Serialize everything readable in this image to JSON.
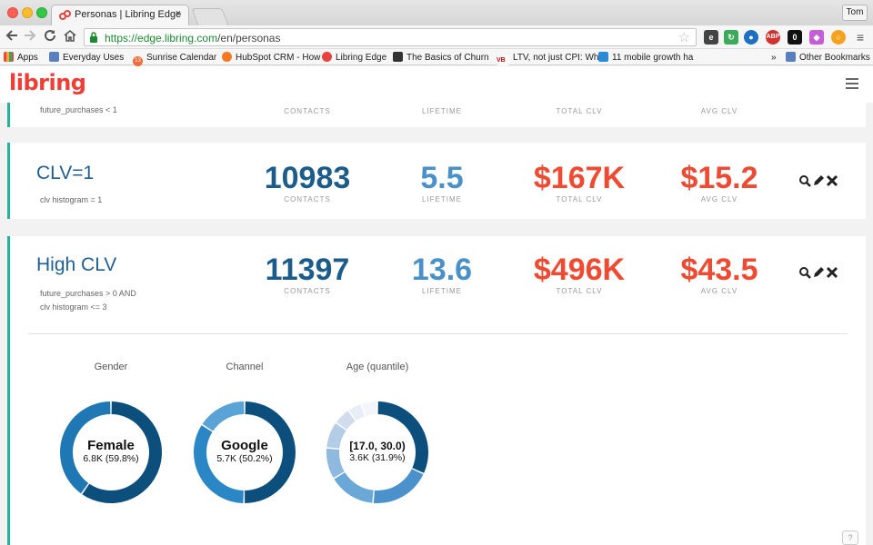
{
  "browser": {
    "tab_title": "Personas | Libring Edge",
    "tab_close": "×",
    "user_label": "Tom",
    "url_secure": "https://edge.libring.com",
    "url_path": "/en/personas",
    "bookmarks": [
      {
        "label": "Apps"
      },
      {
        "label": "Everyday Uses"
      },
      {
        "label": "Sunrise Calendar"
      },
      {
        "label": "HubSpot CRM - How"
      },
      {
        "label": "Libring Edge"
      },
      {
        "label": "The Basics of Churn"
      },
      {
        "label": "LTV, not just CPI: Wh"
      },
      {
        "label": "11 mobile growth ha"
      },
      {
        "label": "»"
      },
      {
        "label": "Other Bookmarks"
      }
    ],
    "sunrise_badge": "13",
    "ext_abp": "ABP",
    "ext_vb": "VB"
  },
  "app": {
    "logo": "libring"
  },
  "top_card": {
    "rule": "future_purchases < 1",
    "labels": [
      "CONTACTS",
      "LIFETIME",
      "TOTAL CLV",
      "AVG CLV"
    ]
  },
  "cards": [
    {
      "name": "CLV=1",
      "rule_lines": [
        "clv histogram = 1"
      ],
      "contacts": "10983",
      "lifetime": "5.5",
      "total_clv": "$167K",
      "avg_clv": "$15.2",
      "labels": [
        "CONTACTS",
        "LIFETIME",
        "TOTAL CLV",
        "AVG CLV"
      ]
    },
    {
      "name": "High CLV",
      "rule_lines": [
        "future_purchases > 0 AND",
        "clv histogram <= 3"
      ],
      "contacts": "11397",
      "lifetime": "13.6",
      "total_clv": "$496K",
      "avg_clv": "$43.5",
      "labels": [
        "CONTACTS",
        "LIFETIME",
        "TOTAL CLV",
        "AVG CLV"
      ]
    }
  ],
  "donuts": [
    {
      "title": "Gender",
      "main": "Female",
      "sub": "6.8K (59.8%)",
      "segments": [
        59.8,
        40.2
      ],
      "colors": [
        "#0d4f7c",
        "#1f78b4"
      ]
    },
    {
      "title": "Channel",
      "main": "Google",
      "sub": "5.7K (50.2%)",
      "segments": [
        50.2,
        34.0,
        15.8
      ],
      "colors": [
        "#0d4f7c",
        "#2b86c5",
        "#5aa3d6"
      ]
    },
    {
      "title": "Age (quantile)",
      "main": "[17.0, 30.0)",
      "sub": "3.6K (31.9%)",
      "segments": [
        31.9,
        19.5,
        15.0,
        10.0,
        8.5,
        5.5,
        4.5,
        5.1
      ],
      "colors": [
        "#0d4f7c",
        "#4b92cc",
        "#6aa8d8",
        "#8fb9df",
        "#b4cde6",
        "#d1dcee",
        "#e8edf6",
        "#f3f5fa"
      ]
    }
  ],
  "help_label": "?"
}
